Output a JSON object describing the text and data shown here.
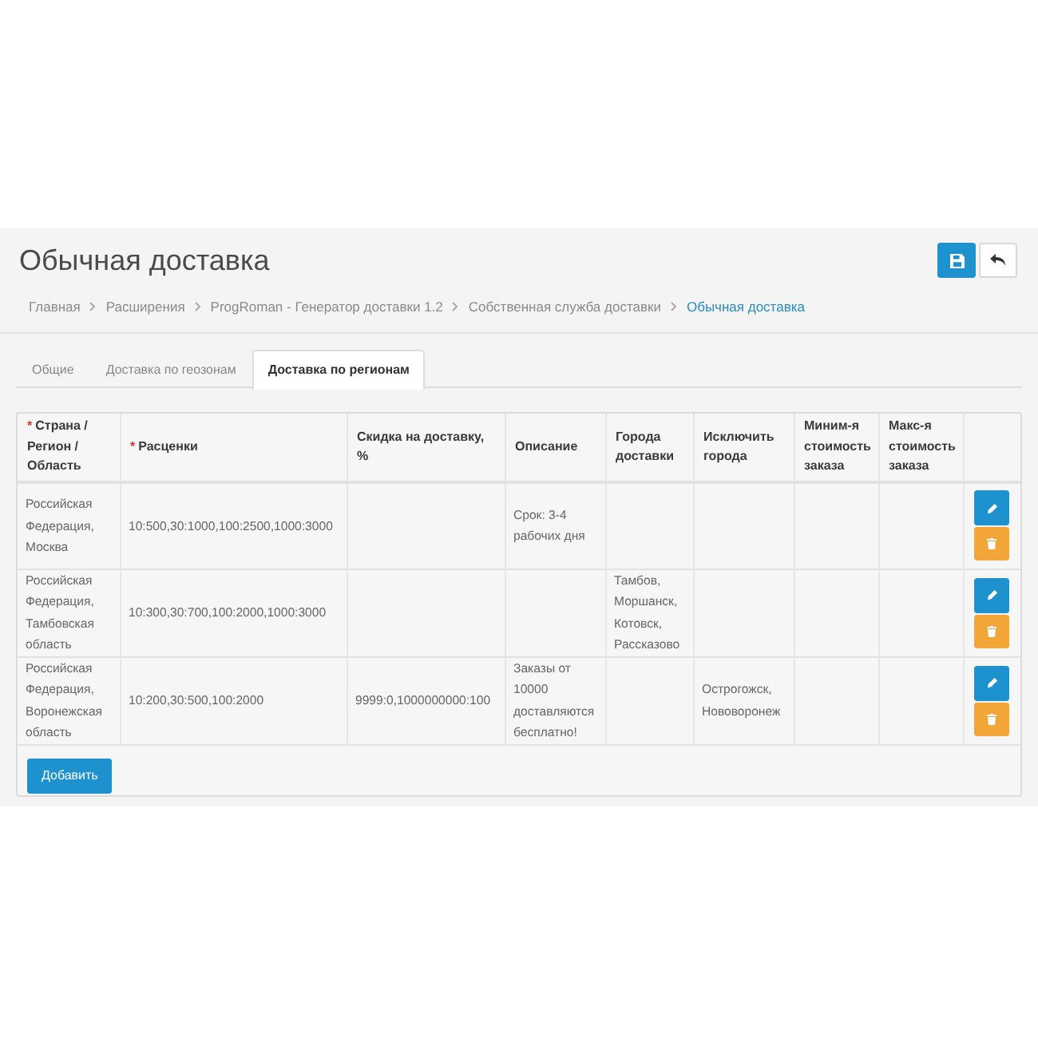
{
  "page": {
    "title": "Обычная доставка"
  },
  "breadcrumb": [
    {
      "label": "Главная",
      "selected": false
    },
    {
      "label": "Расширения",
      "selected": false
    },
    {
      "label": "ProgRoman - Генератор доставки 1.2",
      "selected": false
    },
    {
      "label": "Собственная служба доставки",
      "selected": false
    },
    {
      "label": "Обычная доставка",
      "selected": true
    }
  ],
  "tabs": [
    {
      "label": "Общие",
      "selected": false
    },
    {
      "label": "Доставка по геозонам",
      "selected": false
    },
    {
      "label": "Доставка по регионам",
      "selected": true
    }
  ],
  "table": {
    "columns": [
      {
        "label": "Страна / Регион / Область",
        "required_mark": "*"
      },
      {
        "label": "Расценки",
        "required_mark": "*"
      },
      {
        "label": "Скидка на доставку, %"
      },
      {
        "label": "Описание"
      },
      {
        "label": "Города доставки"
      },
      {
        "label": "Исключить города"
      },
      {
        "label": "Миним-я стоимость заказа"
      },
      {
        "label": "Макс-я стоимость заказа"
      }
    ],
    "rows": [
      {
        "region": "Российская Федерация, Москва",
        "rates": "10:500,30:1000,100:2500,1000:3000",
        "description": "Срок: 3-4 рабочих дня"
      },
      {
        "region": "Российская Федерация, Тамбовская область",
        "rates": "10:300,30:700,100:2000,1000:3000",
        "delivery_cities": "Тамбов, Моршанск, Котовск, Рассказово"
      },
      {
        "region": "Российская Федерация, Воронежская область",
        "rates": "10:200,30:500,100:2000",
        "discount": "9999:0,1000000000:100",
        "description": "Заказы от 10000 доставляются бесплатно!",
        "excluded_cities": "Острогожск, Нововоронеж"
      }
    ]
  },
  "add_button": {
    "label": "Добавить"
  }
}
